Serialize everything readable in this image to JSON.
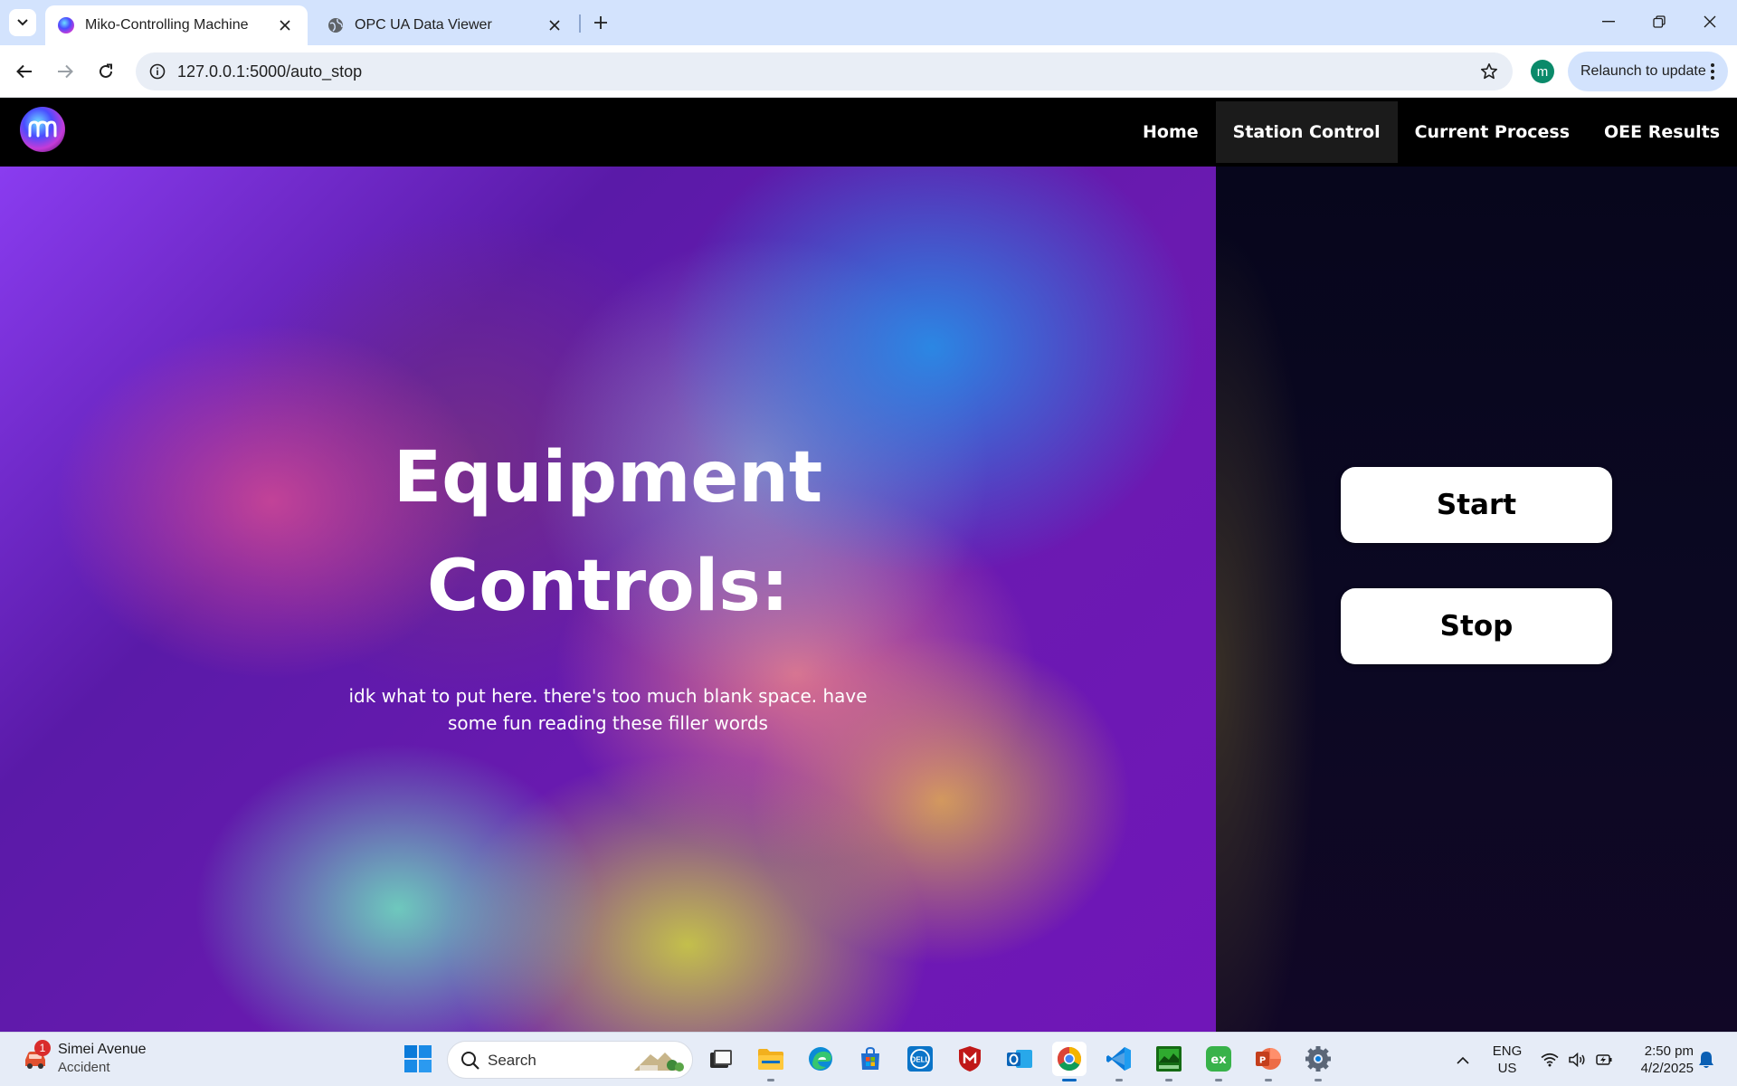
{
  "browser": {
    "tabs": [
      {
        "title": "Miko-Controlling Machine",
        "active": true
      },
      {
        "title": "OPC UA Data Viewer",
        "active": false
      }
    ],
    "url": "127.0.0.1:5000/auto_stop",
    "profile_initial": "m",
    "relaunch_label": "Relaunch to update"
  },
  "site": {
    "nav": [
      "Home",
      "Station Control",
      "Current Process",
      "OEE Results"
    ],
    "active_nav": "Station Control",
    "hero": {
      "title_line1": "Equipment",
      "title_line2": "Controls:",
      "subtitle": "idk what to put here. there's too much blank space. have some fun reading these filler words"
    },
    "controls": {
      "start_label": "Start",
      "stop_label": "Stop"
    }
  },
  "taskbar": {
    "weather": {
      "title": "Simei Avenue",
      "subtitle": "Accident",
      "badge": "1"
    },
    "search_placeholder": "Search",
    "apps": [
      "task-view",
      "file-explorer",
      "edge",
      "store",
      "dell",
      "mcafee",
      "outlook",
      "chrome",
      "vscode",
      "app-green",
      "excel-ext",
      "powerpoint",
      "settings"
    ],
    "lang_line1": "ENG",
    "lang_line2": "US",
    "time": "2:50 pm",
    "date": "4/2/2025"
  },
  "colors": {
    "accent_blue": "#0067c0",
    "tabstrip": "#d3e3fd",
    "nav_bg": "#000000",
    "panel_bg": "#0b0822"
  }
}
